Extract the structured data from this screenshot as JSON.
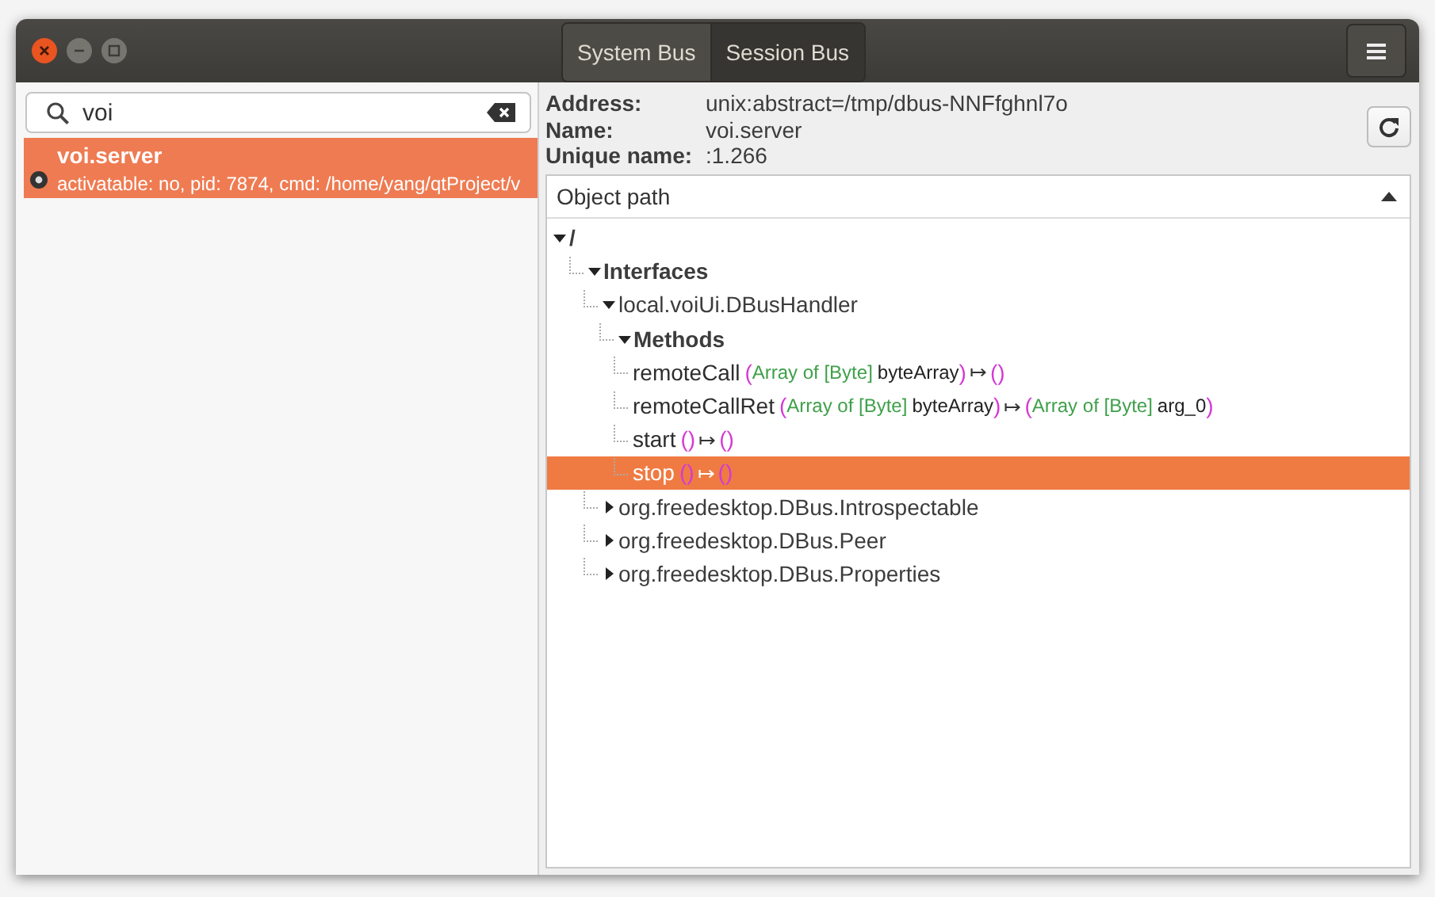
{
  "window": {
    "tabs": [
      {
        "label": "System Bus",
        "selected": false
      },
      {
        "label": "Session Bus",
        "selected": true
      }
    ]
  },
  "sidebar": {
    "search": {
      "value": "voi"
    },
    "items": [
      {
        "name": "voi.server",
        "detail": "activatable: no, pid: 7874, cmd: /home/yang/qtProject/v",
        "selected": true
      }
    ]
  },
  "details": {
    "fields": [
      {
        "label": "Address:",
        "value": "unix:abstract=/tmp/dbus-NNFfghnl7o"
      },
      {
        "label": "Name:",
        "value": "voi.server"
      },
      {
        "label": "Unique name:",
        "value": ":1.266"
      }
    ],
    "tree": {
      "column": "Object path",
      "nodes": [
        {
          "kind": "path",
          "label": "/",
          "expanded": true,
          "selected": false,
          "children": [
            {
              "kind": "group",
              "label": "Interfaces",
              "expanded": true,
              "selected": false,
              "children": [
                {
                  "kind": "interface",
                  "label": "local.voiUi.DBusHandler",
                  "expanded": true,
                  "selected": false,
                  "children": [
                    {
                      "kind": "group",
                      "label": "Methods",
                      "expanded": true,
                      "selected": false,
                      "children": [
                        {
                          "kind": "method",
                          "label": "remoteCall",
                          "selected": false,
                          "signature": [
                            {
                              "kind": "paren",
                              "text": "("
                            },
                            {
                              "kind": "type",
                              "text": "Array of [Byte]"
                            },
                            {
                              "kind": "arg",
                              "text": "byteArray"
                            },
                            {
                              "kind": "paren",
                              "text": ")"
                            },
                            {
                              "kind": "arrow",
                              "text": "↦"
                            },
                            {
                              "kind": "paren",
                              "text": "()"
                            }
                          ]
                        },
                        {
                          "kind": "method",
                          "label": "remoteCallRet",
                          "selected": false,
                          "signature": [
                            {
                              "kind": "paren",
                              "text": "("
                            },
                            {
                              "kind": "type",
                              "text": "Array of [Byte]"
                            },
                            {
                              "kind": "arg",
                              "text": "byteArray"
                            },
                            {
                              "kind": "paren",
                              "text": ")"
                            },
                            {
                              "kind": "arrow",
                              "text": "↦"
                            },
                            {
                              "kind": "paren",
                              "text": "("
                            },
                            {
                              "kind": "type",
                              "text": "Array of [Byte]"
                            },
                            {
                              "kind": "arg",
                              "text": "arg_0"
                            },
                            {
                              "kind": "paren",
                              "text": ")"
                            }
                          ]
                        },
                        {
                          "kind": "method",
                          "label": "start",
                          "selected": false,
                          "signature": [
                            {
                              "kind": "paren",
                              "text": "()"
                            },
                            {
                              "kind": "arrow",
                              "text": "↦"
                            },
                            {
                              "kind": "paren",
                              "text": "()"
                            }
                          ]
                        },
                        {
                          "kind": "method",
                          "label": "stop",
                          "selected": true,
                          "signature": [
                            {
                              "kind": "paren",
                              "text": "()"
                            },
                            {
                              "kind": "arrow",
                              "text": "↦"
                            },
                            {
                              "kind": "paren",
                              "text": "()"
                            }
                          ]
                        }
                      ]
                    }
                  ]
                },
                {
                  "kind": "interface",
                  "label": "org.freedesktop.DBus.Introspectable",
                  "expanded": false,
                  "selected": false
                },
                {
                  "kind": "interface",
                  "label": "org.freedesktop.DBus.Peer",
                  "expanded": false,
                  "selected": false
                },
                {
                  "kind": "interface",
                  "label": "org.freedesktop.DBus.Properties",
                  "expanded": false,
                  "selected": false
                }
              ]
            }
          ]
        }
      ]
    }
  }
}
